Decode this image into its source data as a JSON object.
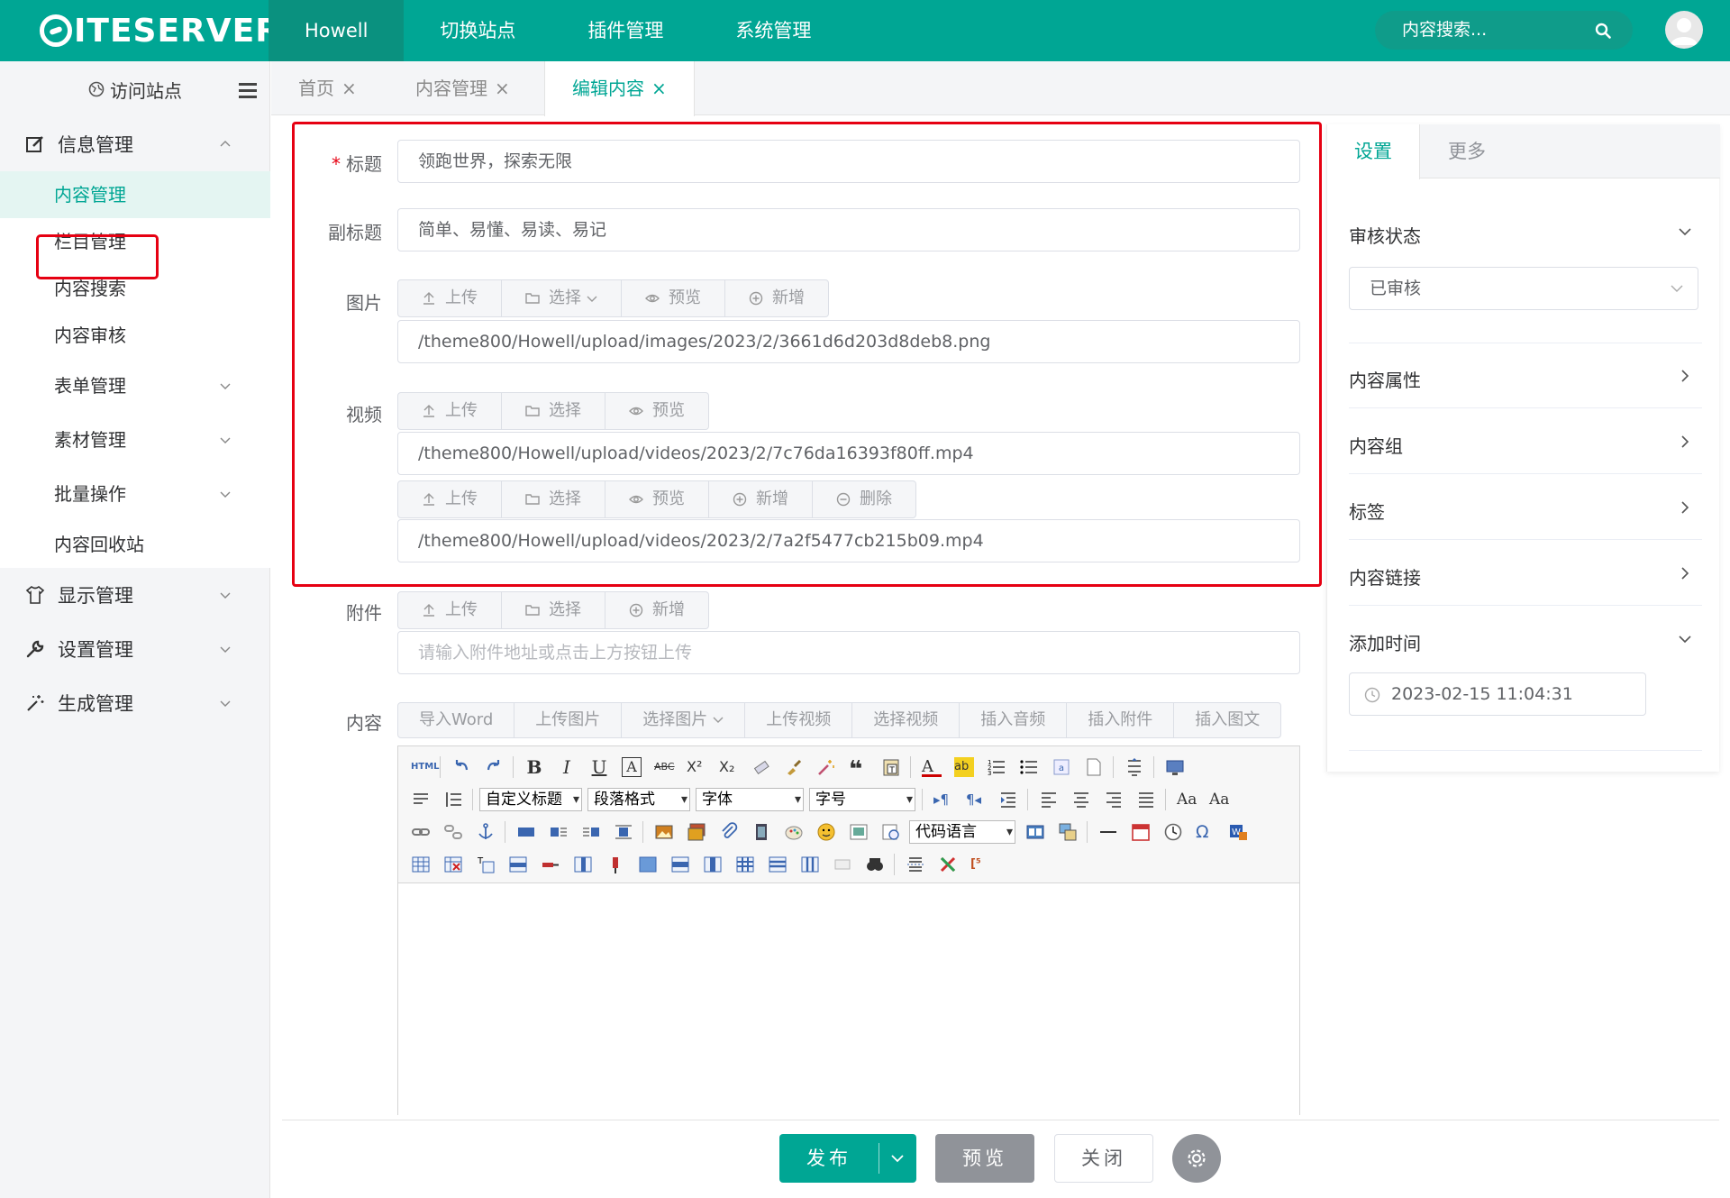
{
  "header": {
    "logo": "ITESERVER",
    "nav": [
      "Howell",
      "切换站点",
      "插件管理",
      "系统管理"
    ],
    "search_placeholder": "内容搜索..."
  },
  "sidebar": {
    "visit_site": "访问站点",
    "groups": [
      {
        "label": "信息管理",
        "icon": "edit-icon",
        "expanded": true,
        "items": [
          "内容管理",
          "栏目管理",
          "内容搜索",
          "内容审核",
          "表单管理",
          "素材管理",
          "批量操作",
          "内容回收站"
        ]
      },
      {
        "label": "显示管理",
        "icon": "shirt-icon"
      },
      {
        "label": "设置管理",
        "icon": "wrench-icon"
      },
      {
        "label": "生成管理",
        "icon": "magic-wand-icon"
      }
    ]
  },
  "tabs": [
    {
      "label": "首页"
    },
    {
      "label": "内容管理"
    },
    {
      "label": "编辑内容",
      "active": true
    }
  ],
  "form": {
    "title_label": "标题",
    "title_value": "领跑世界，探索无限",
    "subtitle_label": "副标题",
    "subtitle_value": "简单、易懂、易读、易记",
    "image_label": "图片",
    "image_buttons": [
      "上传",
      "选择",
      "预览",
      "新增"
    ],
    "image_value": "/theme800/Howell/upload/images/2023/2/3661d6d203d8deb8.png",
    "video_label": "视频",
    "video_buttons": [
      "上传",
      "选择",
      "预览"
    ],
    "video_value": "/theme800/Howell/upload/videos/2023/2/7c76da16393f80ff.mp4",
    "video2_buttons": [
      "上传",
      "选择",
      "预览",
      "新增",
      "删除"
    ],
    "video2_value": "/theme800/Howell/upload/videos/2023/2/7a2f5477cb215b09.mp4",
    "attachment_label": "附件",
    "attachment_buttons": [
      "上传",
      "选择",
      "新增"
    ],
    "attachment_placeholder": "请输入附件地址或点击上方按钮上传",
    "content_label": "内容",
    "content_buttons": [
      "导入Word",
      "上传图片",
      "选择图片",
      "上传视频",
      "选择视频",
      "插入音频",
      "插入附件",
      "插入图文"
    ],
    "editor_selects": {
      "custom_title": "自定义标题",
      "paragraph": "段落格式",
      "font": "字体",
      "size": "字号",
      "code": "代码语言"
    }
  },
  "right_panel": {
    "tabs": [
      "设置",
      "更多"
    ],
    "audit_label": "审核状态",
    "audit_value": "已审核",
    "sections": [
      "内容属性",
      "内容组",
      "标签",
      "内容链接"
    ],
    "add_time_label": "添加时间",
    "add_time_value": "2023-02-15 11:04:31"
  },
  "footer": {
    "publish": "发布",
    "preview": "预览",
    "close": "关闭"
  },
  "colors": {
    "primary": "#00a694",
    "highlight": "#e60012"
  }
}
